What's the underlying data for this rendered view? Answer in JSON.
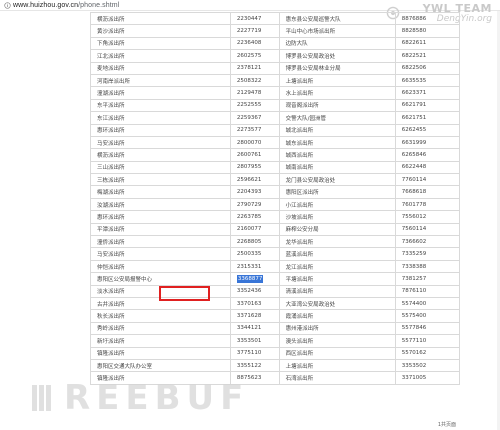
{
  "browser": {
    "url_host": "www.huizhou.gov.cn",
    "url_path": "/phone.shtml"
  },
  "watermark": {
    "team": "YWL TEAM",
    "site": "DengYin.org",
    "freebuf": "REEBUF"
  },
  "table": {
    "rows": [
      [
        "横沥派出所",
        "2230447",
        "惠东县公安局巡警大队",
        "8876886"
      ],
      [
        "黄沙派出所",
        "2227719",
        "平山中心市场派出所",
        "8828580"
      ],
      [
        "下角派出所",
        "2236408",
        "边防大队",
        "6822611"
      ],
      [
        "江北派出所",
        "2602575",
        "博罗县公安局政治处",
        "6822521"
      ],
      [
        "麦地派出所",
        "2378121",
        "博罗县公安局林业分局",
        "6822506"
      ],
      [
        "河南岸派出所",
        "2508322",
        "上塘派出所",
        "6635535"
      ],
      [
        "潼湖派出所",
        "2129478",
        "水上派出所",
        "6623371"
      ],
      [
        "东平派出所",
        "2252555",
        "观音阁派出所",
        "6621791"
      ],
      [
        "东江派出所",
        "2259367",
        "交警大队/园洲管",
        "6621751"
      ],
      [
        "惠环派出所",
        "2273577",
        "城北派出所",
        "6262455"
      ],
      [
        "马安派出所",
        "2800070",
        "城东派出所",
        "6631999"
      ],
      [
        "横沥派出所",
        "2600761",
        "城西派出所",
        "6265846"
      ],
      [
        "三山派出所",
        "2807955",
        "城南派出所",
        "6622448"
      ],
      [
        "三栋派出所",
        "2596621",
        "龙门县公安局政治处",
        "7760114"
      ],
      [
        "梅湖派出所",
        "2204393",
        "惠阳区派出所",
        "7668618"
      ],
      [
        "汝湖派出所",
        "2790729",
        "小江派出所",
        "7601778"
      ],
      [
        "惠环派出所",
        "2263785",
        "沙坡派出所",
        "7556012"
      ],
      [
        "平潭派出所",
        "2160077",
        "麻榨公安分局",
        "7560114"
      ],
      [
        "潼侨派出所",
        "2268805",
        "龙华派出所",
        "7366602"
      ],
      [
        "马安派出所",
        "2500335",
        "蓝溪派出所",
        "7335259"
      ],
      [
        "仲恺派出所",
        "2315331",
        "龙江派出所",
        "7338388"
      ],
      [
        "惠阳区公安局报警中心",
        "3368877",
        "平塘派出所",
        "7381257"
      ],
      [
        "淡水派出所",
        "3352436",
        "清溪派出所",
        "7876110"
      ],
      [
        "古井派出所",
        "3370163",
        "大亚湾公安局政治处",
        "5574400"
      ],
      [
        "秋长派出所",
        "3371628",
        "霞涌派出所",
        "5575400"
      ],
      [
        "秀岭派出所",
        "3344121",
        "惠州港派出所",
        "5577846"
      ],
      [
        "新圩派出所",
        "3353501",
        "澳头派出所",
        "5577110"
      ],
      [
        "镇隆派出所",
        "3775110",
        "西区派出所",
        "5570162"
      ],
      [
        "惠阳区交通大队办公室",
        "3355122",
        "上塘派出所",
        "3353502"
      ],
      [
        "镇隆派出所",
        "8875623",
        "石湾派出所",
        "3371005"
      ]
    ],
    "selected_value": "3368877",
    "pagination": "1共页面"
  }
}
